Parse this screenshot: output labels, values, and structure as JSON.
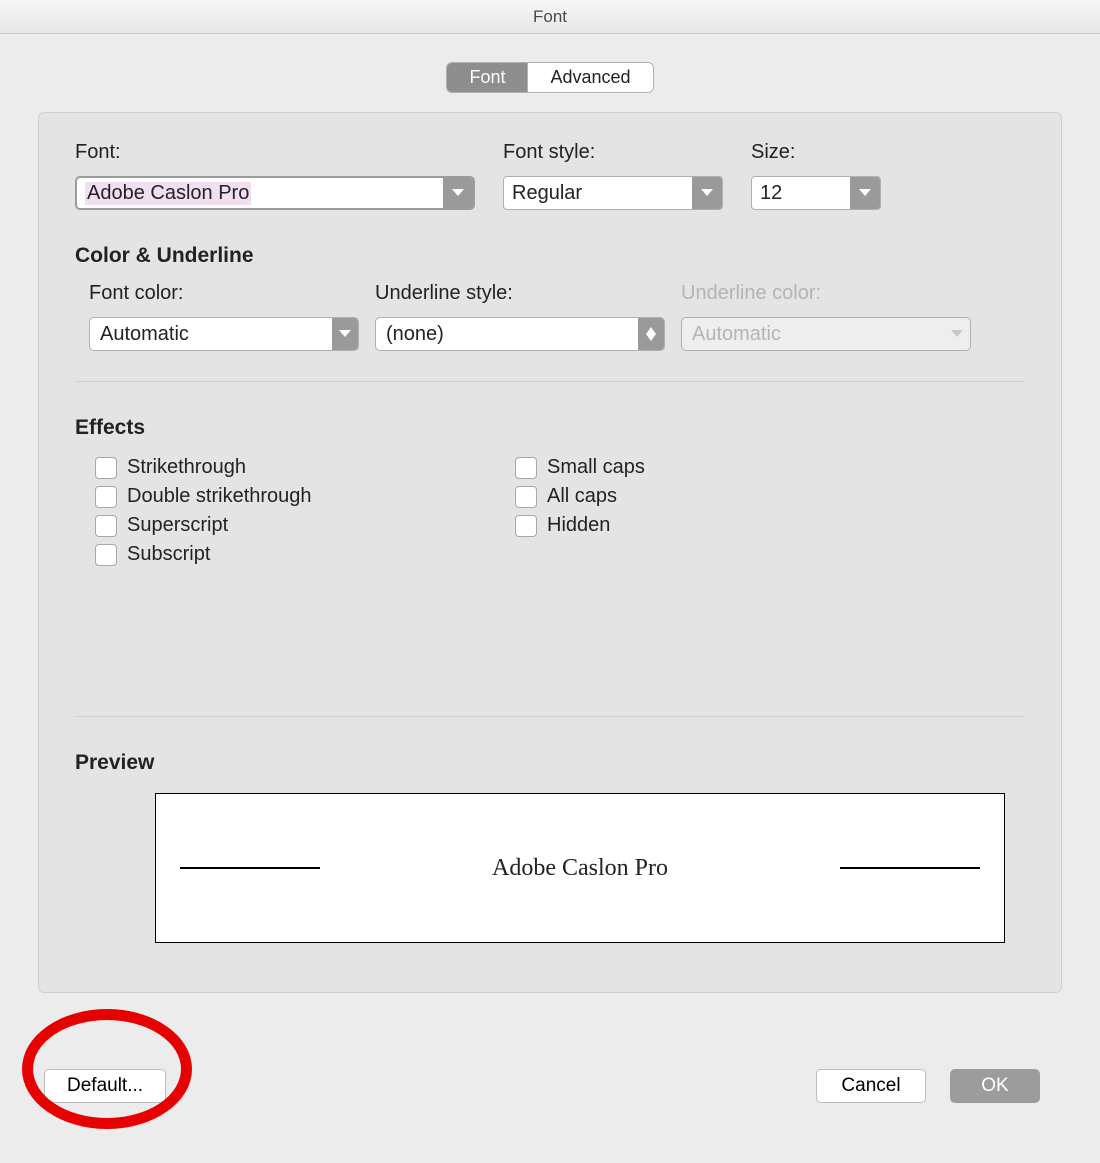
{
  "window": {
    "title": "Font"
  },
  "tabs": {
    "font": "Font",
    "advanced": "Advanced"
  },
  "labels": {
    "font": "Font:",
    "font_style": "Font style:",
    "size": "Size:",
    "color_underline": "Color & Underline",
    "font_color": "Font color:",
    "underline_style": "Underline style:",
    "underline_color": "Underline color:",
    "effects": "Effects",
    "preview": "Preview"
  },
  "values": {
    "font": "Adobe Caslon Pro",
    "font_style": "Regular",
    "size": "12",
    "font_color": "Automatic",
    "underline_style": "(none)",
    "underline_color": "Automatic",
    "preview_text": "Adobe Caslon Pro"
  },
  "effects": {
    "strikethrough": "Strikethrough",
    "double_strikethrough": "Double strikethrough",
    "superscript": "Superscript",
    "subscript": "Subscript",
    "small_caps": "Small caps",
    "all_caps": "All caps",
    "hidden": "Hidden"
  },
  "buttons": {
    "default": "Default...",
    "cancel": "Cancel",
    "ok": "OK"
  }
}
